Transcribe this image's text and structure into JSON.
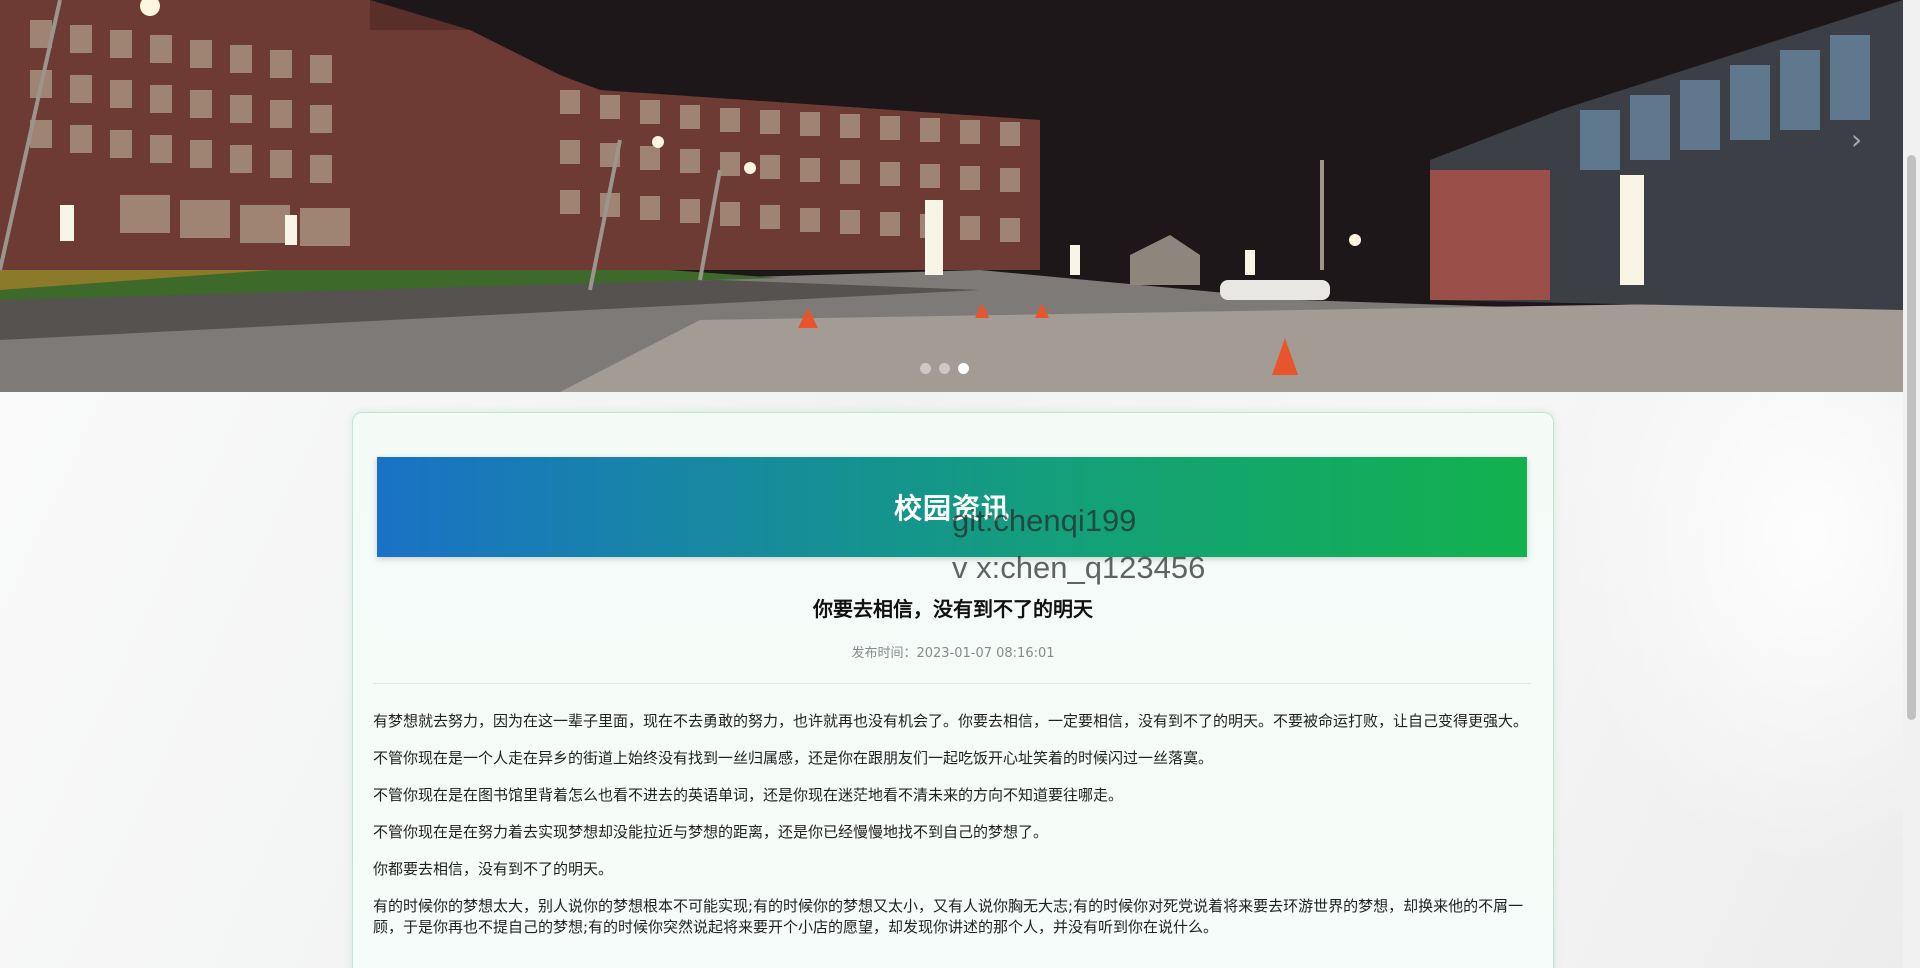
{
  "banner": {
    "slides": 3,
    "active_slide": 3,
    "next_arrow": "›"
  },
  "card": {
    "header_title": "校园资讯",
    "watermark_lines": [
      "git:chenqi199",
      "v x:chen_q123456"
    ],
    "article": {
      "title": "你要去相信，没有到不了的明天",
      "meta": "发布时间：2023-01-07 08:16:01",
      "paragraphs": [
        "有梦想就去努力，因为在这一辈子里面，现在不去勇敢的努力，也许就再也没有机会了。你要去相信，一定要相信，没有到不了的明天。不要被命运打败，让自己变得更强大。",
        "不管你现在是一个人走在异乡的街道上始终没有找到一丝归属感，还是你在跟朋友们一起吃饭开心址笑着的时候闪过一丝落寞。",
        "不管你现在是在图书馆里背着怎么也看不进去的英语单词，还是你现在迷茫地看不清未来的方向不知道要往哪走。",
        "不管你现在是在努力着去实现梦想却没能拉近与梦想的距离，还是你已经慢慢地找不到自己的梦想了。",
        "你都要去相信，没有到不了的明天。",
        "有的时候你的梦想太大，别人说你的梦想根本不可能实现;有的时候你的梦想又太小，又有人说你胸无大志;有的时候你对死党说着将来要去环游世界的梦想，却换来他的不屑一顾，于是你再也不提自己的梦想;有的时候你突然说起将来要开个小店的愿望，却发现你讲述的那个人，并没有听到你在说什么。"
      ]
    }
  },
  "colors": {
    "header_gradient_start": "#1a72c6",
    "header_gradient_end": "#13b14e",
    "card_border": "#bfe6d0"
  }
}
